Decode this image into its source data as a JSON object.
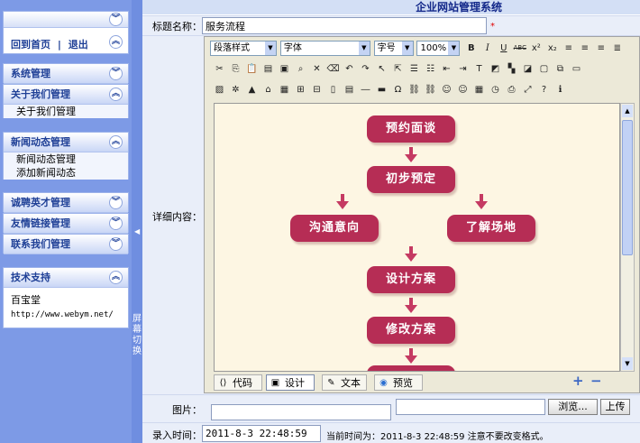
{
  "sidebar": {
    "nav": {
      "home": "回到首页",
      "sep": "|",
      "logout": "退出"
    },
    "sections": [
      {
        "title": "系统管理",
        "items": []
      },
      {
        "title": "关于我们管理",
        "items": [
          "关于我们管理"
        ]
      },
      {
        "title": "新闻动态管理",
        "items": [
          "新闻动态管理",
          "添加新闻动态"
        ]
      },
      {
        "title": "诚聘英才管理",
        "items": []
      },
      {
        "title": "友情链接管理",
        "items": []
      },
      {
        "title": "联系我们管理",
        "items": []
      }
    ],
    "support": {
      "title": "技术支持",
      "name": "百宝堂",
      "url": "http://www.webym.net/"
    }
  },
  "splitter": {
    "label": "屏幕切换"
  },
  "header": {
    "title": "企业网站管理系统"
  },
  "form": {
    "title_label": "标题名称：",
    "title_value": "服务流程",
    "required_mark": "*",
    "content_label": "详细内容：",
    "image_label": "图片：",
    "browse_button": "浏览...",
    "upload_button": "上传",
    "time_label": "录入时间：",
    "time_value": "2011-8-3 22:48:59",
    "time_note": "当前时间为：2011-8-3 22:48:59 注意不要改变格式。"
  },
  "editor": {
    "paragraph_select": "段落样式",
    "font_select": "字体",
    "size_select": "字号",
    "zoom_select": "100%",
    "tabs": [
      "代码",
      "设计",
      "文本",
      "预览"
    ],
    "active_tab": "设计",
    "zoom_in": "+",
    "zoom_out": "−"
  },
  "flowchart": {
    "nodes": [
      "预约面谈",
      "初步预定",
      "沟通意向",
      "了解场地",
      "设计方案",
      "修改方案"
    ],
    "node_color": "#b62d55"
  }
}
